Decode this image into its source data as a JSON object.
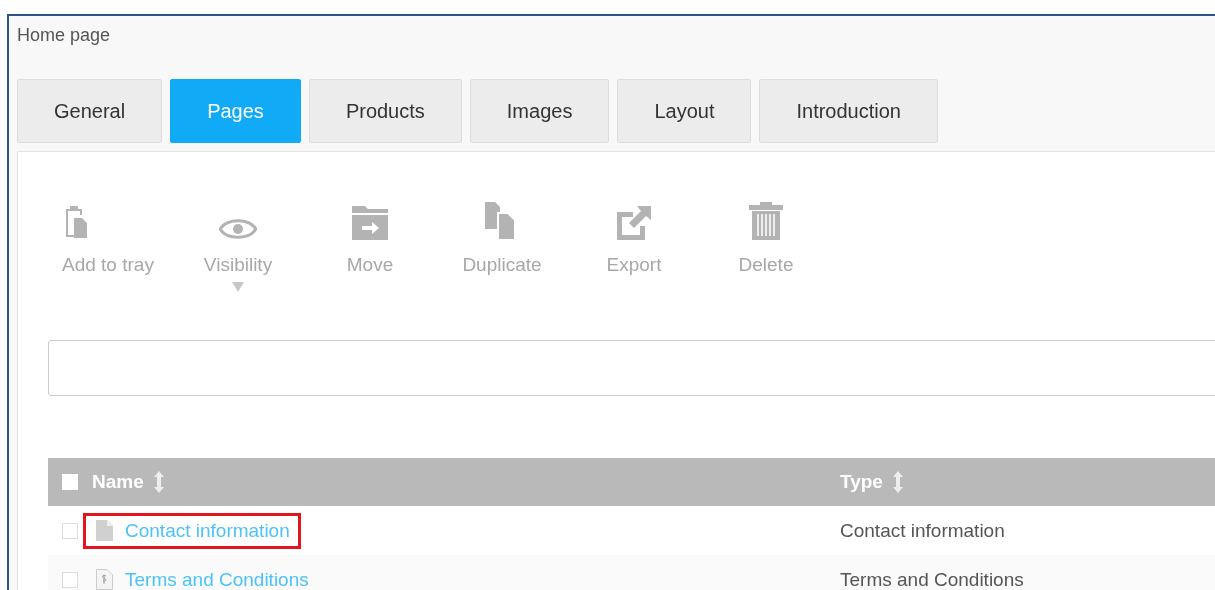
{
  "window": {
    "title": "Home page"
  },
  "tabs": [
    {
      "label": "General",
      "selected": false
    },
    {
      "label": "Pages",
      "selected": true
    },
    {
      "label": "Products",
      "selected": false
    },
    {
      "label": "Images",
      "selected": false
    },
    {
      "label": "Layout",
      "selected": false
    },
    {
      "label": "Introduction",
      "selected": false
    }
  ],
  "toolbar": [
    {
      "kind": "tray",
      "label": "Add to tray",
      "disabled": true,
      "has_menu": false
    },
    {
      "kind": "visibility",
      "label": "Visibility",
      "disabled": true,
      "has_menu": true
    },
    {
      "kind": "move",
      "label": "Move",
      "disabled": true,
      "has_menu": false
    },
    {
      "kind": "duplicate",
      "label": "Duplicate",
      "disabled": true,
      "has_menu": false
    },
    {
      "kind": "export",
      "label": "Export",
      "disabled": true,
      "has_menu": false
    },
    {
      "kind": "delete",
      "label": "Delete",
      "disabled": true,
      "has_menu": false
    }
  ],
  "table": {
    "select_all": {
      "checked": false
    },
    "columns": [
      {
        "label": "Name"
      },
      {
        "label": "Type"
      }
    ],
    "rows": [
      {
        "kind": "page",
        "name": "Contact information",
        "type": "Contact information",
        "checked": false,
        "highlighted": true
      },
      {
        "kind": "terms",
        "name": "Terms and Conditions",
        "type": "Terms and Conditions",
        "checked": false,
        "highlighted": false
      }
    ]
  }
}
